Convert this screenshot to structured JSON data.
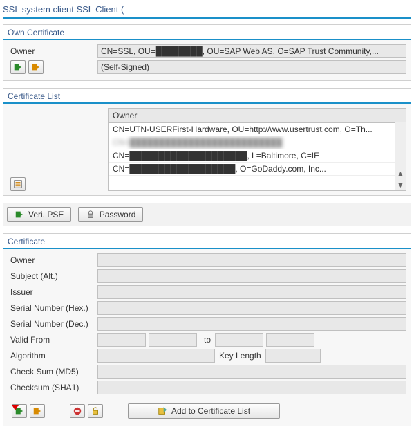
{
  "title": "SSL system client SSL Client (",
  "ownCert": {
    "panel_title": "Own Certificate",
    "owner_label": "Owner",
    "owner_value": "CN=SSL, OU=████████, OU=SAP Web AS, O=SAP Trust Community,...",
    "self_signed": "(Self-Signed)"
  },
  "certList": {
    "panel_title": "Certificate List",
    "header": "Owner",
    "rows": [
      "CN=UTN-USERFirst-Hardware, OU=http://www.usertrust.com, O=Th...",
      "CN=██████████████████████████",
      "CN=████████████████████, L=Baltimore, C=IE",
      "CN=██████████████████, O=GoDaddy.com, Inc..."
    ]
  },
  "midbar": {
    "veri_pse": "Veri. PSE",
    "password": "Password"
  },
  "certificate": {
    "panel_title": "Certificate",
    "owner": "Owner",
    "subject_alt": "Subject (Alt.)",
    "issuer": "Issuer",
    "serial_hex": "Serial Number (Hex.)",
    "serial_dec": "Serial Number (Dec.)",
    "valid_from": "Valid From",
    "to": "to",
    "algorithm": "Algorithm",
    "key_length": "Key Length",
    "md5": "Check Sum (MD5)",
    "sha1": "Checksum (SHA1)",
    "add_btn": "Add to Certificate List"
  }
}
